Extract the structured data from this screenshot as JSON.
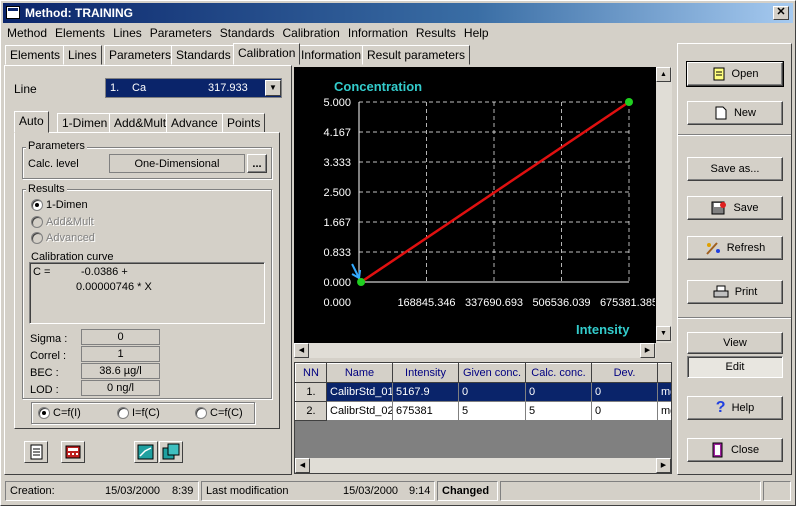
{
  "window": {
    "title": "Method:  TRAINING"
  },
  "menu": [
    "Method",
    "Elements",
    "Lines",
    "Parameters",
    "Standards",
    "Calibration",
    "Information",
    "Results",
    "Help"
  ],
  "tabs": [
    "Elements",
    "Lines",
    "Parameters",
    "Standards",
    "Calibration",
    "Information",
    "Result parameters"
  ],
  "active_tab": "Calibration",
  "line": {
    "label": "Line",
    "number": "1.",
    "element": "Ca",
    "wavelength": "317.933"
  },
  "subtabs": [
    "Auto",
    "1-Dimen",
    "Add&Mult",
    "Advance",
    "Points"
  ],
  "parameters": {
    "title": "Parameters",
    "calc_label": "Calc. level",
    "calc_value": "One-Dimensional",
    "dots": "..."
  },
  "results": {
    "title": "Results",
    "options": [
      "1-Dimen",
      "Add&Mult",
      "Advanced"
    ],
    "curve_title": "Calibration curve",
    "curve_line1": "C =          -0.0386 +",
    "curve_line2": "0.00000746 * X",
    "sigma_label": "Sigma :",
    "sigma": "0",
    "correl_label": "Correl :",
    "correl": "1",
    "bec_label": "BEC :",
    "bec": "38.6 µg/l",
    "lod_label": "LOD :",
    "lod": "0 ng/l"
  },
  "func_options": [
    "C=f(I)",
    "I=f(C)",
    "C=f(C)"
  ],
  "chart_data": {
    "type": "line",
    "title": "Concentration",
    "xlabel": "Intensity",
    "ylabel": "",
    "x": [
      5167.9,
      675381
    ],
    "y": [
      0,
      5
    ],
    "xlim": [
      0,
      675381.385
    ],
    "ylim": [
      0,
      5
    ],
    "xticks": [
      "0.000",
      "168845.346",
      "337690.693",
      "506536.039",
      "675381.385"
    ],
    "yticks": [
      "5.000",
      "4.167",
      "3.333",
      "2.500",
      "1.667",
      "0.833",
      "0.000"
    ],
    "grid": true,
    "colors": {
      "background": "#000000",
      "line": "#e01010",
      "points": "#20d020",
      "title": "#33cccc",
      "grid": "#ffffff"
    }
  },
  "table": {
    "columns": [
      "NN",
      "Name",
      "Intensity",
      "Given conc.",
      "Calc. conc.",
      "Dev.",
      ""
    ],
    "rows": [
      [
        "1.",
        "CalibrStd_01",
        "5167.9",
        "0",
        "0",
        "0",
        "mg"
      ],
      [
        "2.",
        "CalibrStd_02",
        "675381",
        "5",
        "5",
        "0",
        "mg"
      ]
    ]
  },
  "buttons": {
    "open": "Open",
    "new": "New",
    "save_as": "Save as...",
    "save": "Save",
    "refresh": "Refresh",
    "print": "Print",
    "view": "View",
    "edit": "Edit",
    "help": "Help",
    "close": "Close"
  },
  "status": {
    "creation_label": "Creation:",
    "creation_date": "15/03/2000",
    "creation_time": "8:39",
    "modified_label": "Last modification",
    "modified_date": "15/03/2000",
    "modified_time": "9:14",
    "state": "Changed"
  }
}
